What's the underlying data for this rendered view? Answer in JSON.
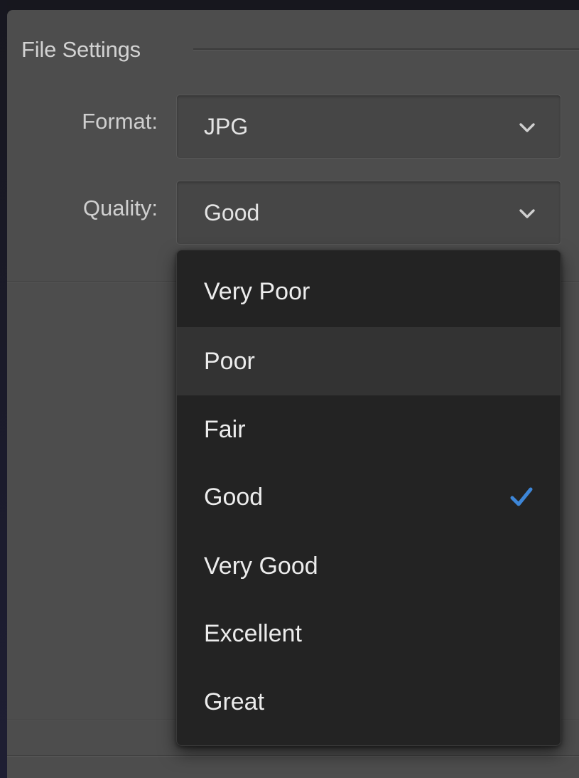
{
  "section": {
    "title": "File Settings"
  },
  "format": {
    "label": "Format:",
    "value": "JPG",
    "icon": "chevron-down-icon"
  },
  "quality": {
    "label": "Quality:",
    "value": "Good",
    "icon": "chevron-down-icon"
  },
  "quality_menu": {
    "hovered": "Poor",
    "selected": "Good",
    "check_icon": "checkmark-icon",
    "check_color": "#3d86d8",
    "options": [
      "Very Poor",
      "Poor",
      "Fair",
      "Good",
      "Very Good",
      "Excellent",
      "Great"
    ]
  }
}
